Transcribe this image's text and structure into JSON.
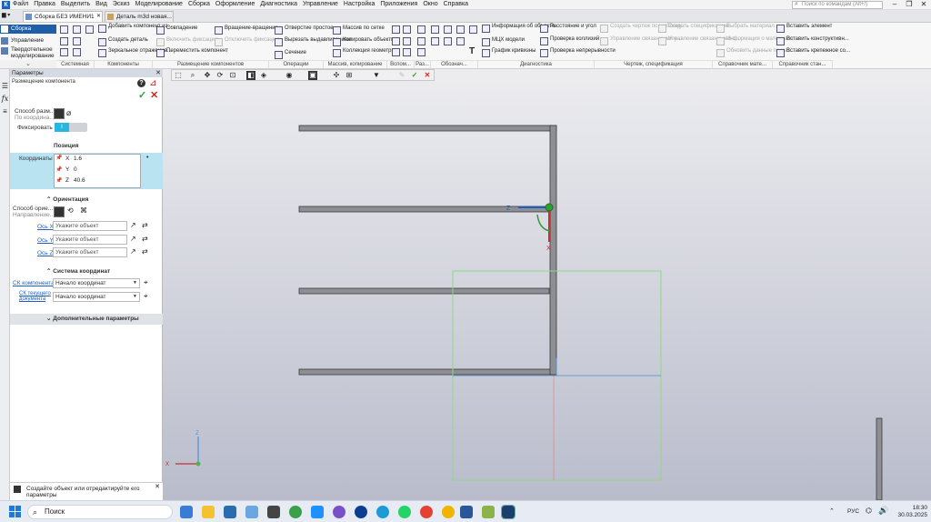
{
  "menubar": {
    "items": [
      "Файл",
      "Правка",
      "Выделить",
      "Вид",
      "Эскиз",
      "Моделирование",
      "Сборка",
      "Оформление",
      "Диагностика",
      "Управление",
      "Настройка",
      "Приложения",
      "Окно",
      "Справка"
    ],
    "search_placeholder": "Поиск по командам (Alt+/)"
  },
  "tabs": [
    {
      "label": "Сборка БЕЗ ИМЕНИ1",
      "close": "✕"
    },
    {
      "label": "Деталь m3d новая..."
    }
  ],
  "ribbon": {
    "mode_tabs": [
      "Сборка",
      "Управление",
      "Твердотельное моделирование"
    ],
    "col1": [
      "Добавить компонент из...",
      "Создать деталь",
      "Зеркальное отражение..."
    ],
    "col2": [
      "Совпадение",
      "Включить фиксацию",
      "Переместить компонент"
    ],
    "col3": [
      "Вращение-вращение",
      "Отключить фиксацию"
    ],
    "col4": [
      "Отверстие простое",
      "Вырезать выдавливанием",
      "Сечение"
    ],
    "col5": [
      "Массив по сетке",
      "Копировать объекты",
      "Коллекция геометрии"
    ],
    "col6": [
      "Информация об объекте",
      "МЦХ модели",
      "График кривизны"
    ],
    "col7": [
      "Расстояние и угол",
      "Проверка коллизий",
      "Проверка непрерывности"
    ],
    "col8": [
      "Создать чертеж по шаблону",
      "Управление связанными ч..."
    ],
    "col9": [
      "Создать спецификацию",
      "Управление связанными с..."
    ],
    "col10": [
      "Выбрать материал...",
      "Информация о материале",
      "Обновить данные по мат..."
    ],
    "col11": [
      "Вставить элемент",
      "Вставить конструктивн...",
      "Вставить крепежное со..."
    ],
    "groups": [
      "Системная",
      "Компоненты",
      "Размещение компонентов",
      "Операции",
      "Массив, копирование",
      "Вспом...",
      "Раз...",
      "Обознач...",
      "Диагностика",
      "Чертеж, спецификация",
      "Справочник мате...",
      "Справочник стан..."
    ]
  },
  "panel": {
    "title": "Параметры",
    "subtitle": "Размещение компонента",
    "method_label": "Способ разм...",
    "method_sub": "По координа...",
    "fix_label": "Фиксировать",
    "fix_value": "I",
    "position_header": "Позиция",
    "coord_label": "Координаты",
    "coords": [
      {
        "axis": "X",
        "value": "1.6"
      },
      {
        "axis": "Y",
        "value": "0"
      },
      {
        "axis": "Z",
        "value": "40.6"
      }
    ],
    "orientation_header": "Ориентация",
    "orient_method": "Способ орие...",
    "orient_dir": "Направление...",
    "axes": [
      {
        "label": "Ось X",
        "placeholder": "Укажите объект"
      },
      {
        "label": "Ось Y",
        "placeholder": "Укажите объект"
      },
      {
        "label": "Ось Z",
        "placeholder": "Укажите объект"
      }
    ],
    "cs_header": "Система координат",
    "cs_component_label": "СК компонента",
    "cs_component_value": "Начало координат",
    "cs_doc_label": "СК текущего документа",
    "cs_doc_value": "Начало координат",
    "extra_header": "Дополнительные параметры",
    "status": "Создайте объект или отредактируйте его параметры"
  },
  "triad": {
    "z": "Z",
    "x": "X"
  },
  "taskbar": {
    "search": "Поиск",
    "lang": "РУС",
    "time": "18:30",
    "date": "30.03.2025"
  },
  "colors": {
    "accent": "#1d5fc0",
    "highlight": "#b9e3f0",
    "ok": "#2f9e3a",
    "cancel": "#d42a2a"
  }
}
